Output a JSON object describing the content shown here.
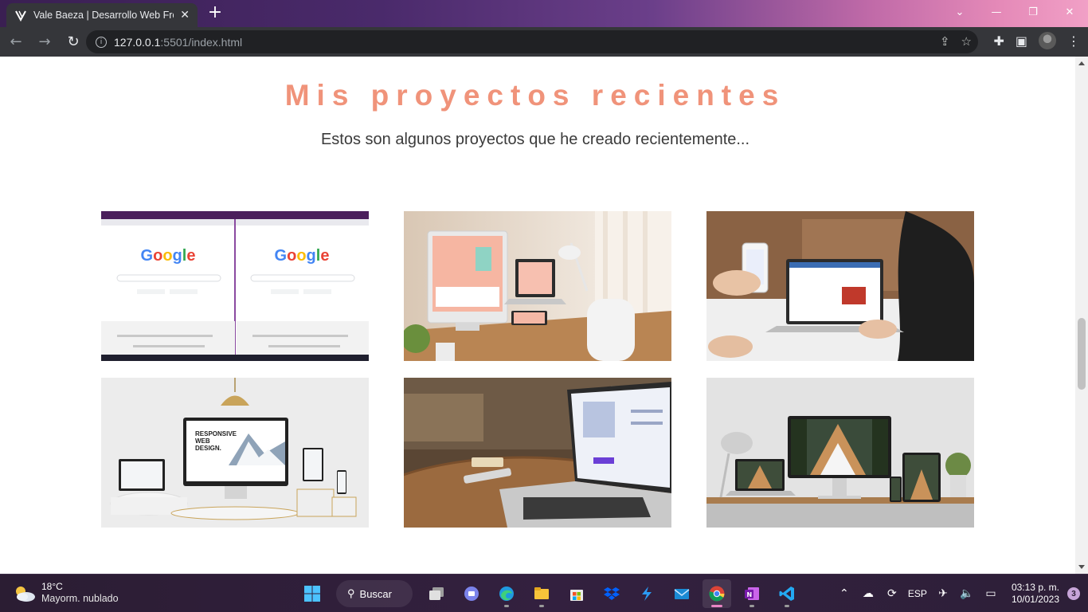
{
  "browser": {
    "tab_title": "Vale Baeza | Desarrollo Web Fron",
    "url_host": "127.0.0.1",
    "url_rest": ":5501/index.html"
  },
  "page": {
    "title": "Mis proyectos recientes",
    "subtitle": "Estos son algunos proyectos que he creado recientemente...",
    "projects": [
      {
        "image": "google-homepage-screenshot"
      },
      {
        "image": "imac-laptop-desk-mockup"
      },
      {
        "image": "hands-phone-laptop-mockup"
      },
      {
        "image": "responsive-web-design-devices"
      },
      {
        "image": "laptop-on-wooden-table"
      },
      {
        "image": "architect-studio-devices-mockup"
      }
    ]
  },
  "taskbar": {
    "weather_temp": "18°C",
    "weather_desc": "Mayorm. nublado",
    "search_label": "Buscar",
    "language": "ESP",
    "time": "03:13 p. m.",
    "date": "10/01/2023",
    "notifications": "3"
  },
  "colors": {
    "accent": "#f0937a",
    "tab_bg": "#35363a"
  }
}
